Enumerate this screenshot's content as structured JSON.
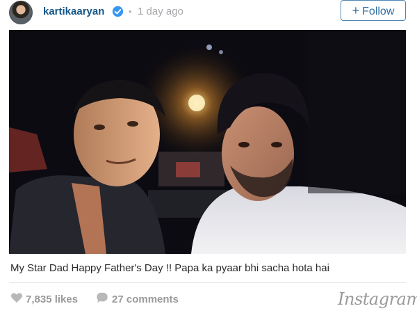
{
  "post": {
    "username": "kartikaaryan",
    "separator": "•",
    "time": "1 day ago",
    "follow_label": "Follow",
    "follow_plus": "+",
    "caption": "My Star Dad Happy Father's Day !! Papa ka pyaar bhi sacha hota hai",
    "likes": "7,835 likes",
    "comments": "27 comments",
    "brand": "Instagram"
  },
  "icons": {
    "verified": "verified-badge-icon",
    "like": "heart-icon",
    "comment": "speech-bubble-icon"
  },
  "colors": {
    "username": "#125688",
    "follow_border": "#4f86b4",
    "verified": "#3897f0",
    "meta": "#a5a7aa"
  }
}
